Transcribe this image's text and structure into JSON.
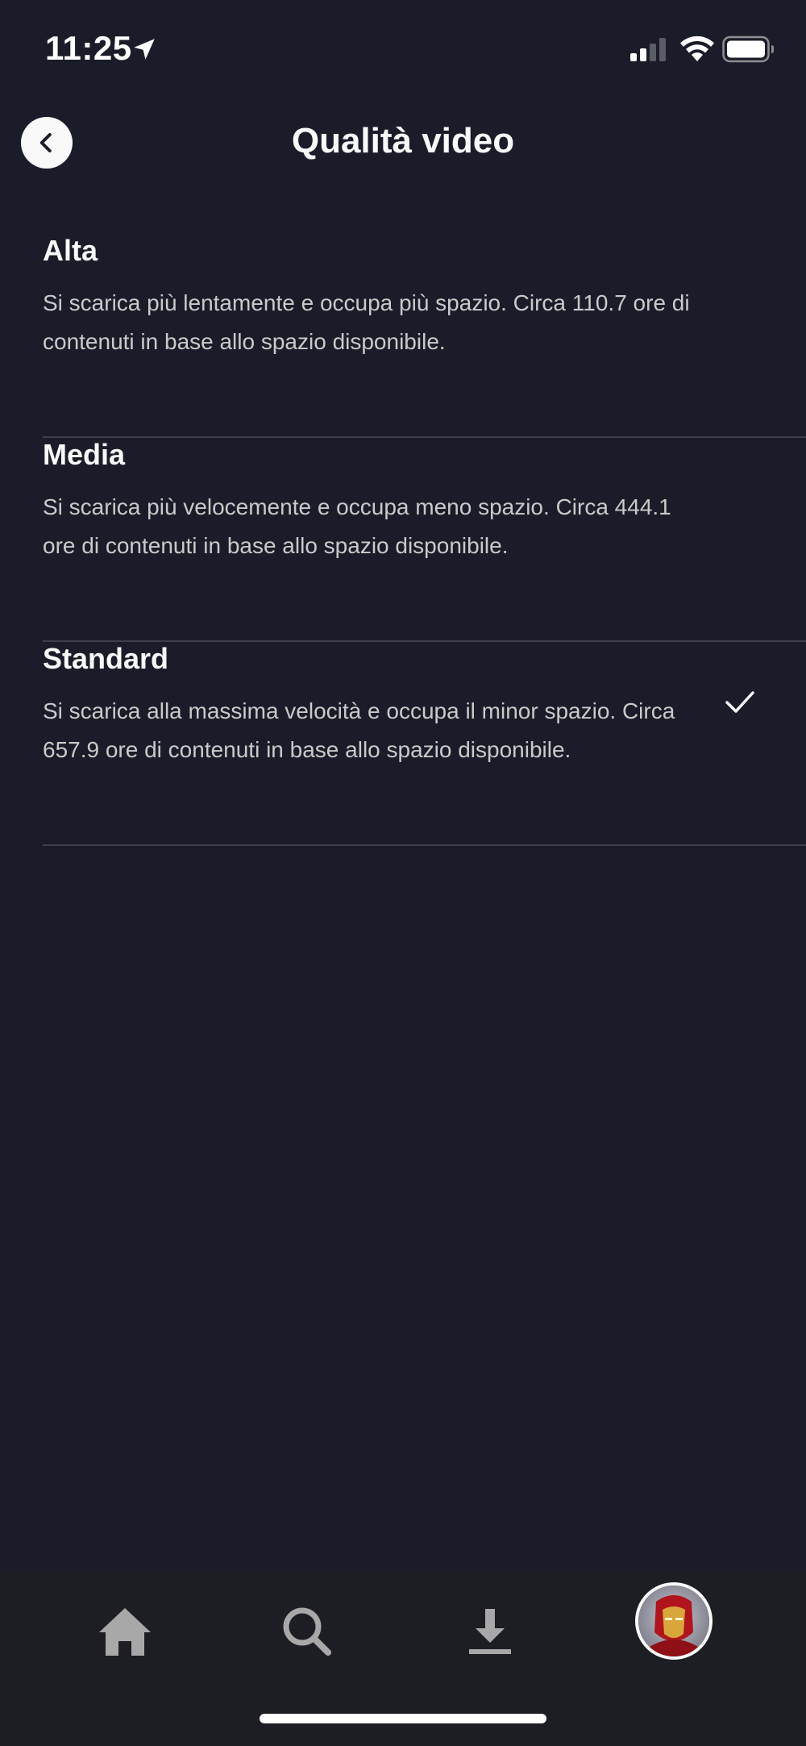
{
  "status_bar": {
    "time": "11:25",
    "icons": [
      "location-arrow-icon",
      "cellular-signal-icon",
      "wifi-icon",
      "battery-icon"
    ]
  },
  "header": {
    "title": "Qualità video",
    "back_icon": "chevron-left-icon"
  },
  "options": [
    {
      "title": "Alta",
      "description": "Si scarica più lentamente e occupa più spazio. Circa 110.7 ore di contenuti in base allo spazio disponibile.",
      "selected": false
    },
    {
      "title": "Media",
      "description": "Si scarica più velocemente e occupa meno spazio. Circa 444.1 ore di contenuti in base allo spazio disponibile.",
      "selected": false
    },
    {
      "title": "Standard",
      "description": "Si scarica alla massima velocità e occupa il minor spazio. Circa 657.9 ore di contenuti in base allo spazio disponibile.",
      "selected": true
    }
  ],
  "tab_bar": {
    "items": [
      {
        "icon": "home-icon"
      },
      {
        "icon": "search-icon"
      },
      {
        "icon": "download-icon"
      },
      {
        "icon": "profile-avatar"
      }
    ]
  },
  "colors": {
    "background": "#1a1d29",
    "tab_bar": "#1d1e24",
    "text_primary": "#f9f9f9",
    "text_secondary": "#cacaca",
    "divider": "#3d404c",
    "icon_inactive": "#a8a8a8"
  }
}
